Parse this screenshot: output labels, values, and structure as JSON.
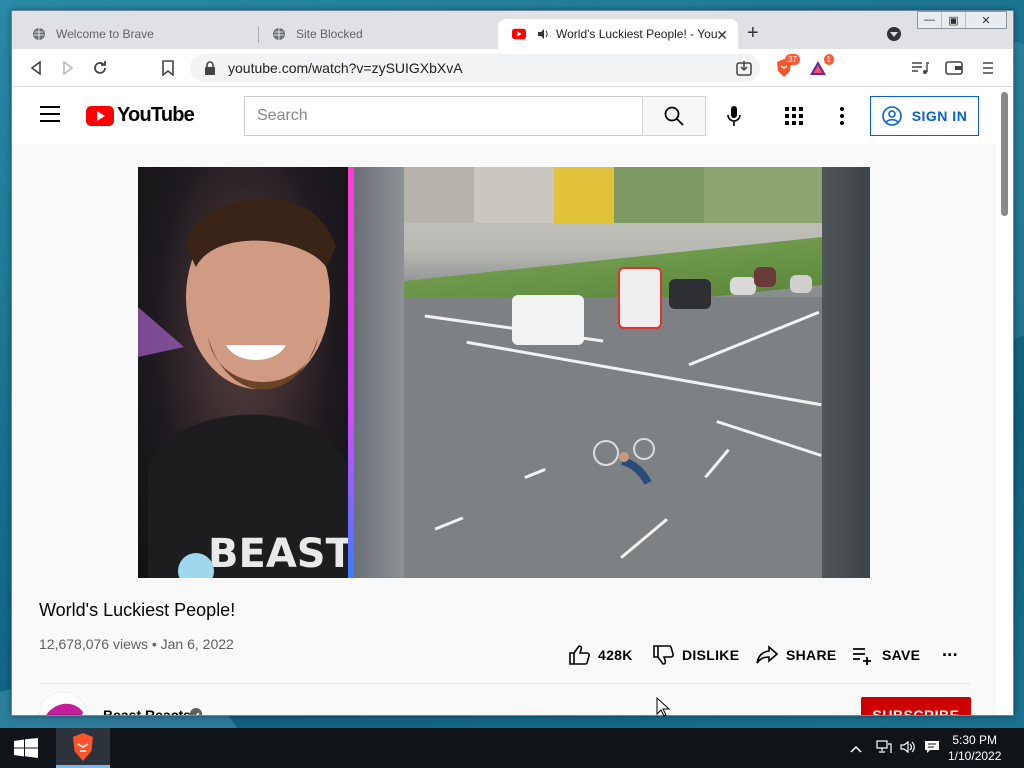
{
  "browser": {
    "tabs": [
      {
        "title": "Welcome to Brave",
        "active": false
      },
      {
        "title": "Site Blocked",
        "active": false
      },
      {
        "title": "World's Luckiest People! - You",
        "active": true
      }
    ],
    "url": "youtube.com/watch?v=zySUIGXbXvA",
    "shields_count": "37",
    "rewards_count": "1"
  },
  "youtube": {
    "logo_text": "YouTube",
    "search_placeholder": "Search",
    "sign_in_label": "SIGN IN",
    "video": {
      "title": "World's Luckiest People!",
      "meta": "12,678,076 views • Jan 6, 2022",
      "likes": "428K",
      "dislike_label": "DISLIKE",
      "share_label": "SHARE",
      "save_label": "SAVE",
      "more_label": "..."
    },
    "channel": {
      "name": "Beast Reacts",
      "subscribe_label": "SUBSCRIBE"
    }
  },
  "taskbar": {
    "time": "5:30 PM",
    "date": "1/10/2022"
  },
  "colors": {
    "youtube_red": "#ff0000",
    "subscribe_red": "#cc0000",
    "link_blue": "#065fd4"
  },
  "icons": [
    "back-icon",
    "forward-icon",
    "reload-icon",
    "bookmark-icon",
    "lock-icon",
    "download-icon",
    "brave-shields-icon",
    "brave-rewards-icon",
    "playlist-icon",
    "wallet-icon",
    "menu-icon",
    "hamburger-icon",
    "search-icon",
    "mic-icon",
    "apps-grid-icon",
    "kebab-icon",
    "account-icon",
    "like-icon",
    "dislike-icon",
    "share-icon",
    "save-icon",
    "verified-icon",
    "windows-start-icon"
  ]
}
